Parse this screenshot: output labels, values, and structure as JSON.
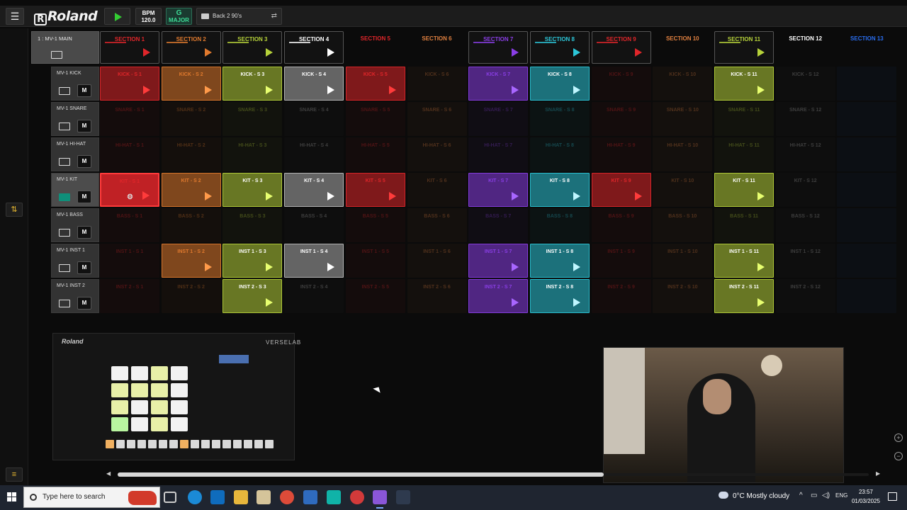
{
  "topbar": {
    "menu_icon": "☰",
    "logo_text": "Roland",
    "logo_r": "R",
    "bpm_label": "BPM",
    "bpm_value": "120.0",
    "key_note": "G",
    "key_scale": "MAJOR",
    "project_name": "Back 2 90's",
    "sync_icon": "⇄"
  },
  "grid": {
    "corner_title": "1 : MV-1 MAIN",
    "sections": [
      {
        "label": "SECTION 1",
        "color": "#e0262a",
        "armed": true
      },
      {
        "label": "SECTION 2",
        "color": "#e07a2e",
        "armed": true
      },
      {
        "label": "SECTION 3",
        "color": "#b6d23a",
        "armed": true
      },
      {
        "label": "SECTION 4",
        "color": "#ffffff",
        "armed": true
      },
      {
        "label": "SECTION 5",
        "color": "#e0262a",
        "armed": false
      },
      {
        "label": "SECTION 6",
        "color": "#e08040",
        "armed": false
      },
      {
        "label": "SECTION 7",
        "color": "#8a3ee6",
        "armed": true
      },
      {
        "label": "SECTION 8",
        "color": "#2cc6d8",
        "armed": true
      },
      {
        "label": "SECTION 9",
        "color": "#e0262a",
        "armed": true
      },
      {
        "label": "SECTION 10",
        "color": "#e08040",
        "armed": false
      },
      {
        "label": "SECTION 11",
        "color": "#b6d23a",
        "armed": true
      },
      {
        "label": "SECTION 12",
        "color": "#ffffff",
        "armed": false
      },
      {
        "label": "SECTION 13",
        "color": "#2a6ef0",
        "armed": false
      }
    ],
    "tracks": [
      {
        "name": "MV-1 KICK",
        "icon": "kbd",
        "mute": "M",
        "selected": false,
        "cells": [
          "KICK - S 1",
          "KICK - S 2",
          "KICK - S 3",
          "KICK - S 4",
          "KICK - S 5",
          "KICK - S 6",
          "KICK - S 7",
          "KICK - S 8",
          "KICK - S 9",
          "KICK - S 10",
          "KICK - S 11",
          "KICK - S 12",
          ""
        ],
        "filled": [
          1,
          1,
          1,
          1,
          1,
          0,
          1,
          1,
          0,
          0,
          1,
          0,
          0
        ]
      },
      {
        "name": "MV-1 SNARE",
        "icon": "kbd",
        "mute": "M",
        "selected": false,
        "cells": [
          "SNARE - S 1",
          "SNARE - S 2",
          "SNARE - S 3",
          "SNARE - S 4",
          "SNARE - S 5",
          "SNARE - S 6",
          "SNARE - S 7",
          "SNARE - S 8",
          "SNARE - S 9",
          "SNARE - S 10",
          "SNARE - S 11",
          "SNARE - S 12",
          ""
        ],
        "filled": [
          0,
          0,
          0,
          0,
          0,
          0,
          0,
          0,
          0,
          0,
          0,
          0,
          0
        ]
      },
      {
        "name": "MV-1 HI-HAT",
        "icon": "kbd",
        "mute": "M",
        "selected": false,
        "cells": [
          "HI-HAT - S 1",
          "HI-HAT - S 2",
          "HI-HAT - S 3",
          "HI-HAT - S 4",
          "HI-HAT - S 5",
          "HI-HAT - S 6",
          "HI-HAT - S 7",
          "HI-HAT - S 8",
          "HI-HAT - S 9",
          "HI-HAT - S 10",
          "HI-HAT - S 11",
          "HI-HAT - S 12",
          ""
        ],
        "filled": [
          0,
          0,
          0,
          0,
          0,
          0,
          0,
          0,
          0,
          0,
          0,
          0,
          0
        ]
      },
      {
        "name": "MV-1 KIT",
        "icon": "kit",
        "mute": "M",
        "selected": true,
        "cells": [
          "KIT - S 1",
          "KIT - S 2",
          "KIT - S 3",
          "KIT - S 4",
          "KIT - S 5",
          "KIT - S 6",
          "KIT - S 7",
          "KIT - S 8",
          "KIT - S 9",
          "KIT - S 10",
          "KIT - S 11",
          "KIT - S 12",
          ""
        ],
        "filled": [
          1,
          1,
          1,
          1,
          1,
          0,
          1,
          1,
          1,
          0,
          1,
          0,
          0
        ]
      },
      {
        "name": "MV-1 BASS",
        "icon": "keys",
        "mute": "M",
        "selected": false,
        "cells": [
          "BASS - S 1",
          "BASS - S 2",
          "BASS - S 3",
          "BASS - S 4",
          "BASS - S 5",
          "BASS - S 6",
          "BASS - S 7",
          "BASS - S 8",
          "BASS - S 9",
          "BASS - S 10",
          "BASS - S 11",
          "BASS - S 12",
          ""
        ],
        "filled": [
          0,
          0,
          0,
          0,
          0,
          0,
          0,
          0,
          0,
          0,
          0,
          0,
          0
        ]
      },
      {
        "name": "MV-1 INST 1",
        "icon": "keys",
        "mute": "M",
        "selected": false,
        "cells": [
          "INST 1 - S 1",
          "INST 1 - S 2",
          "INST 1 - S 3",
          "INST 1 - S 4",
          "INST 1 - S 5",
          "INST 1 - S 6",
          "INST 1 - S 7",
          "INST 1 - S 8",
          "INST 1 - S 9",
          "INST 1 - S 10",
          "INST 1 - S 11",
          "INST 1 - S 12",
          ""
        ],
        "filled": [
          0,
          1,
          1,
          1,
          0,
          0,
          1,
          1,
          0,
          0,
          1,
          0,
          0
        ]
      },
      {
        "name": "MV-1 INST 2",
        "icon": "keys",
        "mute": "M",
        "selected": false,
        "cells": [
          "INST 2 - S 1",
          "INST 2 - S 2",
          "INST 2 - S 3",
          "INST 2 - S 4",
          "INST 2 - S 5",
          "INST 2 - S 6",
          "INST 2 - S 7",
          "INST 2 - S 8",
          "INST 2 - S 9",
          "INST 2 - S 10",
          "INST 2 - S 11",
          "INST 2 - S 12",
          ""
        ],
        "filled": [
          0,
          0,
          1,
          0,
          0,
          0,
          1,
          1,
          0,
          0,
          1,
          0,
          0
        ]
      }
    ]
  },
  "device_preview": {
    "brand": "Roland",
    "model": "VERSELAB"
  },
  "taskbar": {
    "search_placeholder": "Type here to search",
    "weather": "0°C  Mostly cloudy",
    "language": "ENG",
    "time": "23:57",
    "date": "01/03/2025"
  }
}
